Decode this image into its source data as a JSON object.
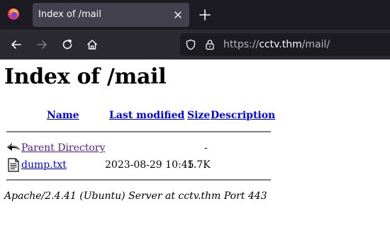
{
  "browser": {
    "tab": {
      "title": "Index of /mail"
    },
    "url": {
      "protocol": "https://",
      "host": "cctv.thm",
      "path": "/mail/"
    }
  },
  "page": {
    "title": "Index of /mail",
    "columns": {
      "name": "Name",
      "modified": "Last modified",
      "size": "Size",
      "description": "Description"
    },
    "rows": [
      {
        "icon": "back-icon",
        "name": "Parent Directory",
        "modified": "",
        "size": "-",
        "description": ""
      },
      {
        "icon": "text-file-icon",
        "name": "dump.txt",
        "modified": "2023-08-29 10:45",
        "size": "1.7K",
        "description": ""
      }
    ],
    "footer": "Apache/2.4.41 (Ubuntu) Server at cctv.thm Port 443"
  },
  "colors": {
    "link": "#0000ee",
    "visited": "#551a8b",
    "tabbar": "#1c1b22",
    "navbar": "#2b2a33"
  }
}
